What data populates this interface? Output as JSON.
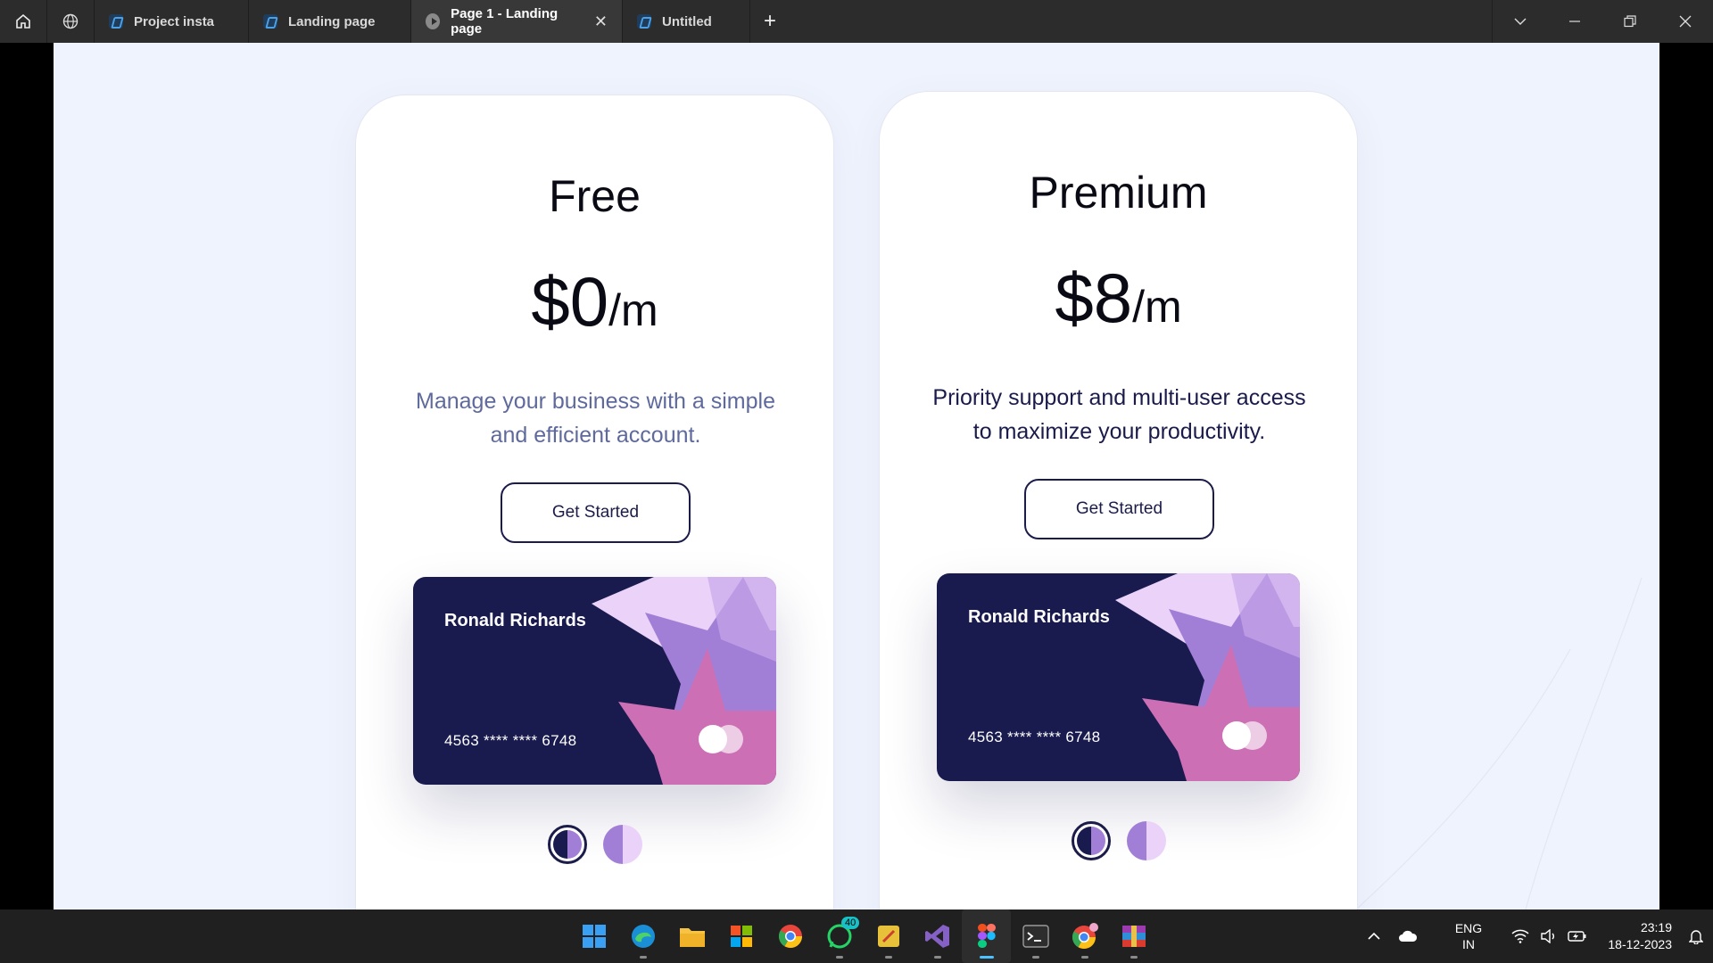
{
  "titlebar": {
    "tabs": [
      {
        "label": "Project insta",
        "active": false
      },
      {
        "label": "Landing page",
        "active": false
      },
      {
        "label": "Page 1 - Landing page",
        "active": true
      },
      {
        "label": "Untitled",
        "active": false
      }
    ]
  },
  "plans": [
    {
      "title": "Free",
      "amount": "$0",
      "period": "/m",
      "description": "Manage your business with a simple and efficient account.",
      "cta": "Get Started",
      "card": {
        "name": "Ronald Richards",
        "number": "4563 **** **** 6748"
      }
    },
    {
      "title": "Premium",
      "amount": "$8",
      "period": "/m",
      "description": "Priority support and multi-user access to maximize your productivity.",
      "cta": "Get Started",
      "card": {
        "name": "Ronald Richards",
        "number": "4563 **** **** 6748"
      }
    }
  ],
  "taskbar": {
    "whatsapp_badge": "40",
    "language": "ENG",
    "region": "IN",
    "time": "23:19",
    "date": "18-12-2023"
  },
  "colors": {
    "card_navy": "#191a4e",
    "accent_purple": "#a27fd6",
    "accent_pink": "#cc6fb4",
    "light_lilac": "#ead2f8",
    "canvas_bg": "#eff3fd"
  }
}
